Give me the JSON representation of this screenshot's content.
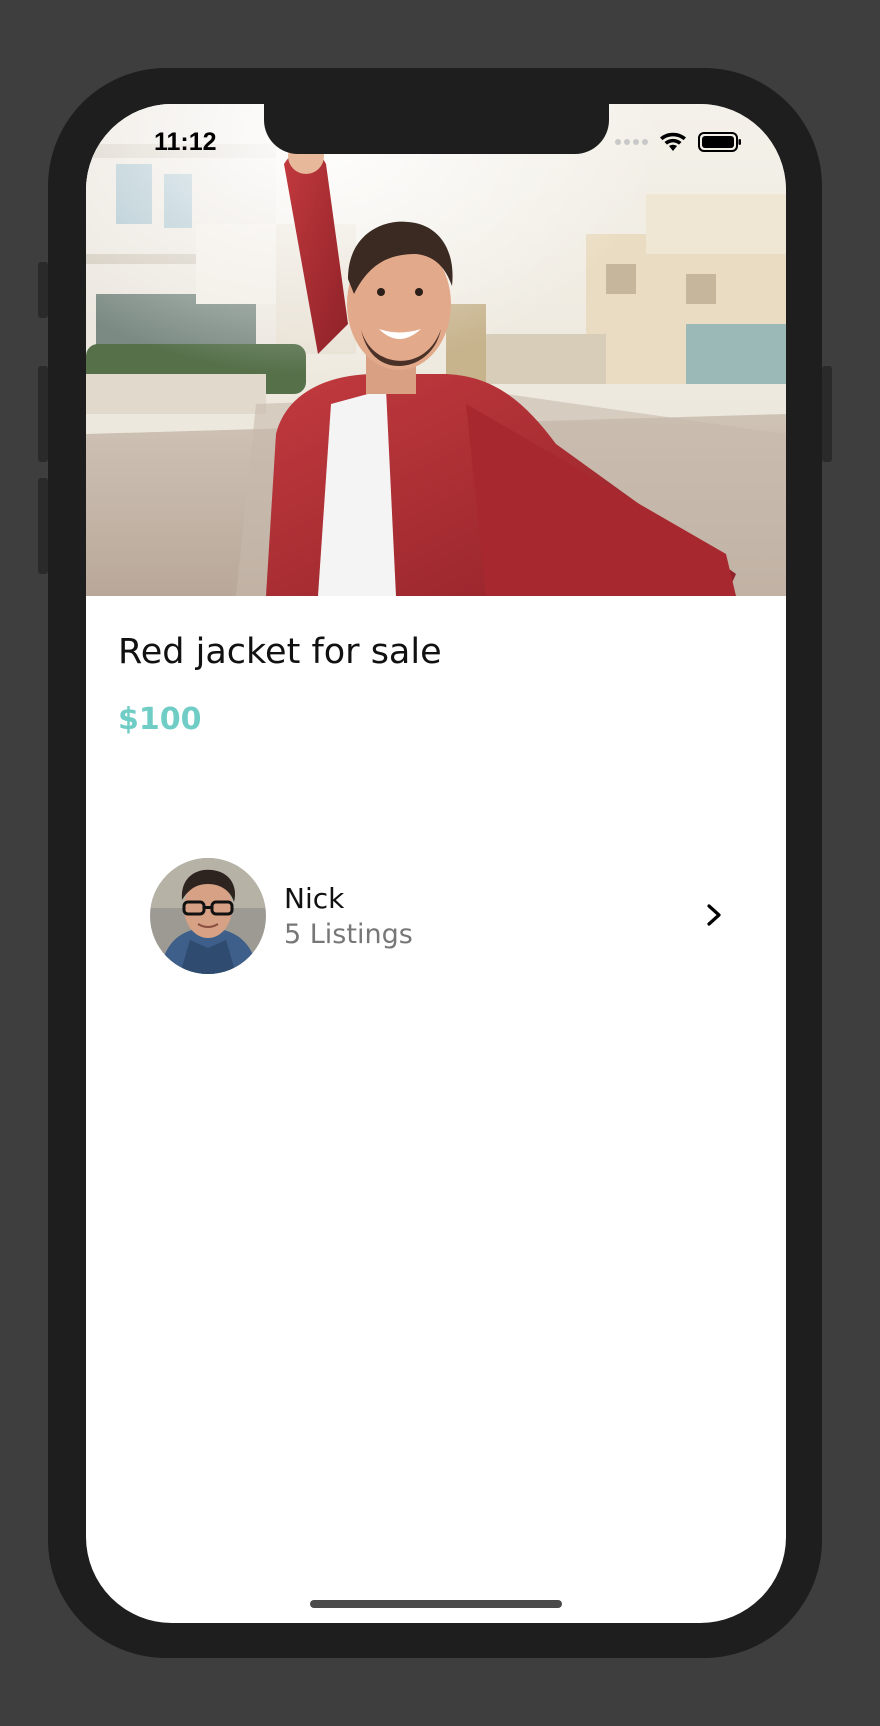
{
  "status_bar": {
    "time": "11:12"
  },
  "listing": {
    "title": "Red jacket for sale",
    "price": "$100",
    "photo_icon": "man-in-red-jacket-selfie-photo"
  },
  "seller": {
    "name": "Nick",
    "listings": "5 Listings",
    "avatar_icon": "seller-avatar-photo",
    "chevron_icon": "chevron-right-icon"
  },
  "colors": {
    "accent": "#6fcdc6",
    "text_primary": "#111111",
    "text_secondary": "#777777",
    "device_frame": "#1e1e1e",
    "background": "#3e3e3e"
  }
}
